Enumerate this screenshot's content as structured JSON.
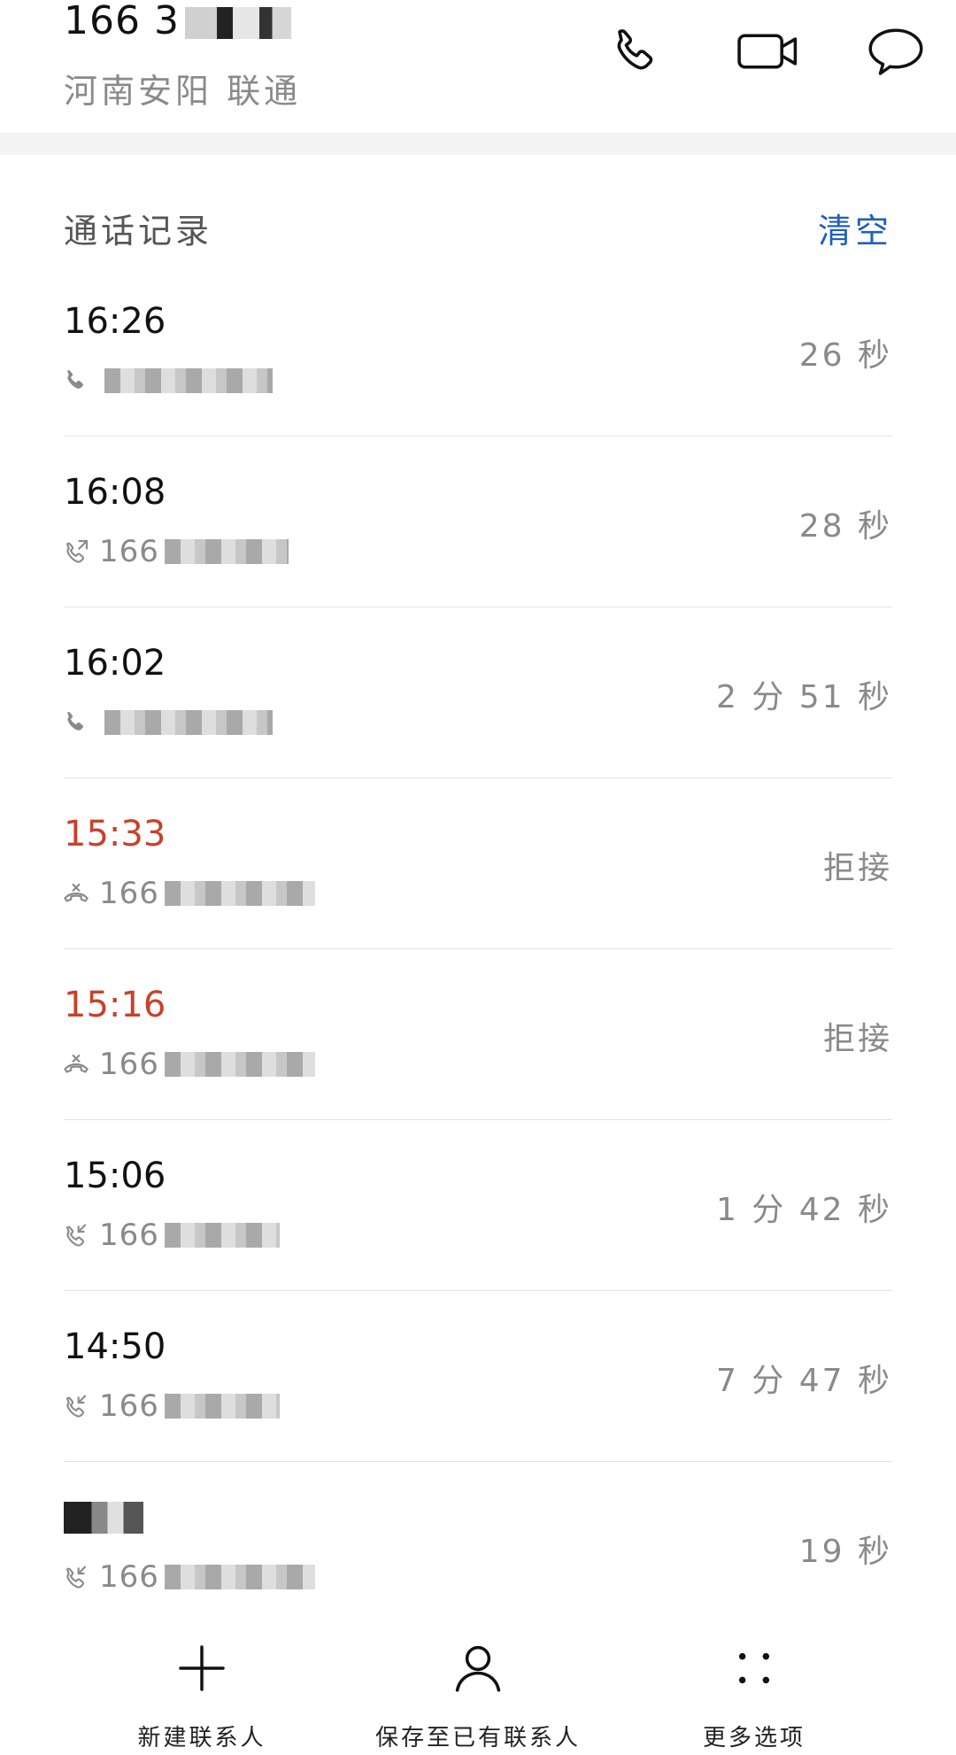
{
  "header": {
    "number": "166 3",
    "location": "河南安阳 联通",
    "actions": {
      "call": "phone-icon",
      "video": "video-camera-icon",
      "message": "message-bubble-icon"
    }
  },
  "section": {
    "title": "通话记录",
    "clear_label": "清空"
  },
  "calls": [
    {
      "time": "16:26",
      "number": "",
      "duration": "26 秒",
      "status": "normal",
      "icon": "call-icon"
    },
    {
      "time": "16:08",
      "number": "166",
      "duration": "28 秒",
      "status": "normal",
      "icon": "outgoing-call-icon"
    },
    {
      "time": "16:02",
      "number": "",
      "duration": "2 分 51 秒",
      "status": "normal",
      "icon": "call-icon"
    },
    {
      "time": "15:33",
      "number": "166",
      "duration": "拒接",
      "status": "missed",
      "icon": "rejected-call-icon"
    },
    {
      "time": "15:16",
      "number": "166",
      "duration": "拒接",
      "status": "missed",
      "icon": "rejected-call-icon"
    },
    {
      "time": "15:06",
      "number": "166",
      "duration": "1 分 42 秒",
      "status": "normal",
      "icon": "incoming-call-icon"
    },
    {
      "time": "14:50",
      "number": "166",
      "duration": "7 分 47 秒",
      "status": "normal",
      "icon": "incoming-call-icon"
    },
    {
      "time": "",
      "number": "166",
      "duration": "19 秒",
      "status": "normal",
      "icon": "incoming-call-icon"
    }
  ],
  "bottom_bar": {
    "new_contact": "新建联系人",
    "save_existing": "保存至已有联系人",
    "more_options": "更多选项"
  },
  "colors": {
    "missed": "#c8412b",
    "accent": "#1f5fbf",
    "secondary_text": "#8a8a8a"
  }
}
